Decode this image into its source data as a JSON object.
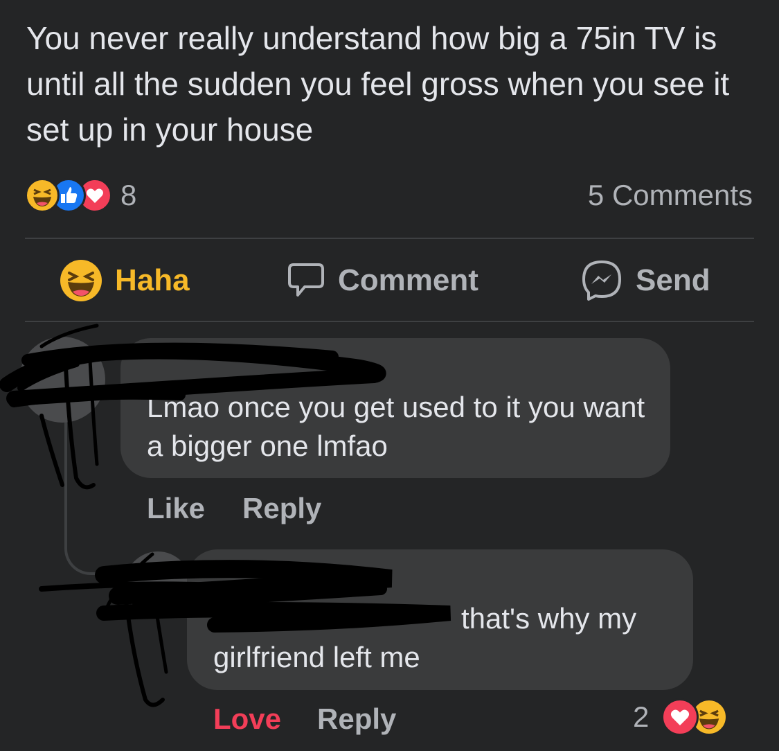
{
  "post": {
    "text": "You never really understand how big a 75in TV is until all the sudden you feel gross when you see it set up in your house",
    "reaction_icons": [
      "haha-icon",
      "like-icon",
      "love-icon"
    ],
    "reaction_count": "8",
    "comments_count": "5 Comments"
  },
  "actions": {
    "haha": "Haha",
    "comment": "Comment",
    "send": "Send"
  },
  "comments": [
    {
      "text": "Lmao once you get used to it you want a bigger one lmfao",
      "like": "Like",
      "reply": "Reply"
    },
    {
      "text": "that's why my girlfriend left me",
      "love": "Love",
      "reply": "Reply",
      "reaction_count": "2",
      "reaction_icons": [
        "love-icon",
        "haha-icon"
      ]
    }
  ],
  "colors": {
    "background": "#242526",
    "bubble": "#3a3b3c",
    "text": "#e4e6eb",
    "muted": "#b0b3b8",
    "haha": "#f7b928",
    "love": "#f33e58",
    "like": "#1877f2"
  }
}
